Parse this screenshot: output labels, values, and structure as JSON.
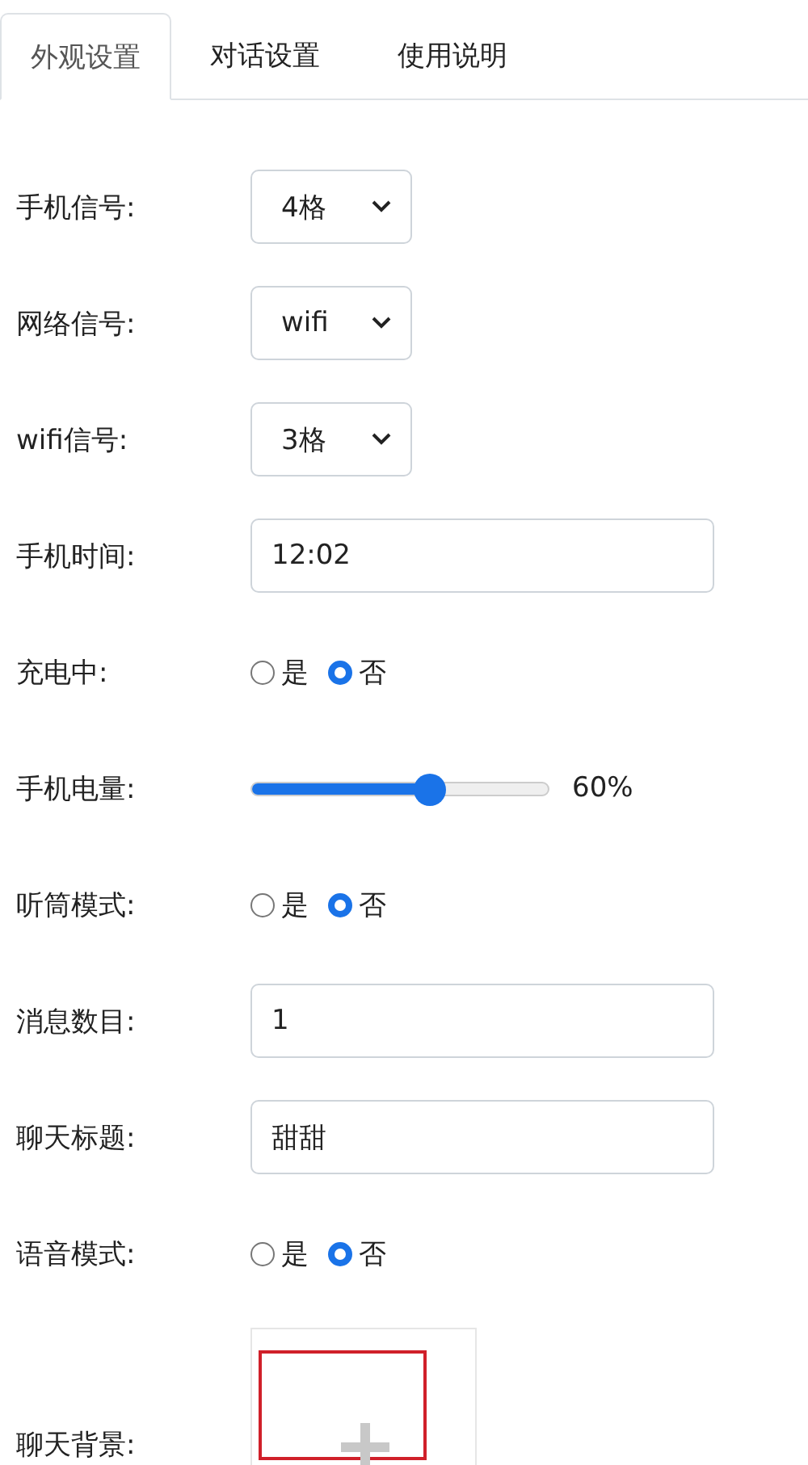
{
  "tabs": [
    {
      "label": "外观设置",
      "selected": true
    },
    {
      "label": "对话设置",
      "selected": false
    },
    {
      "label": "使用说明",
      "selected": false
    }
  ],
  "fields": [
    {
      "kind": "select",
      "label": "手机信号:",
      "value": "4格"
    },
    {
      "kind": "select",
      "label": "网络信号:",
      "value": "wifi"
    },
    {
      "kind": "select",
      "label": "wifi信号:",
      "value": "3格"
    },
    {
      "kind": "input",
      "label": "手机时间:",
      "value": "12:02"
    },
    {
      "kind": "radio",
      "label": "充电中:",
      "options": [
        {
          "label": "是",
          "selected": false
        },
        {
          "label": "否",
          "selected": true
        }
      ]
    },
    {
      "kind": "slider",
      "label": "手机电量:",
      "level": 0.6,
      "reading": "60%"
    },
    {
      "kind": "radio",
      "label": "听筒模式:",
      "options": [
        {
          "label": "是",
          "selected": false
        },
        {
          "label": "否",
          "selected": true
        }
      ]
    },
    {
      "kind": "input",
      "label": "消息数目:",
      "value": "1"
    },
    {
      "kind": "input",
      "label": "聊天标题:",
      "value": "甜甜"
    },
    {
      "kind": "radio",
      "label": "语音模式:",
      "options": [
        {
          "label": "是",
          "selected": false
        },
        {
          "label": "否",
          "selected": true
        }
      ]
    },
    {
      "kind": "upload",
      "label": "聊天背景:"
    }
  ]
}
